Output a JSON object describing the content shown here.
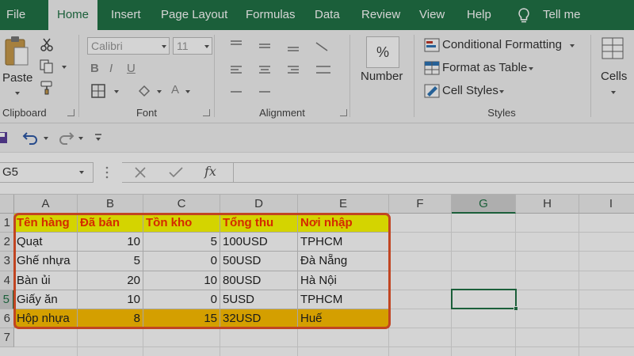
{
  "tabs": {
    "file": "File",
    "home": "Home",
    "insert": "Insert",
    "page_layout": "Page Layout",
    "formulas": "Formulas",
    "data": "Data",
    "review": "Review",
    "view": "View",
    "help": "Help",
    "tell_me": "Tell me"
  },
  "ribbon": {
    "clipboard": {
      "paste_label": "Paste",
      "group_label": "Clipboard"
    },
    "font": {
      "font_name": "Calibri",
      "font_size": "11",
      "group_label": "Font"
    },
    "alignment": {
      "group_label": "Alignment"
    },
    "number": {
      "percent_symbol": "%",
      "label": "Number"
    },
    "styles": {
      "conditional_formatting": "Conditional Formatting",
      "format_as_table": "Format as Table",
      "cell_styles": "Cell Styles",
      "group_label": "Styles"
    },
    "cells": {
      "label": "Cells"
    }
  },
  "formula_bar": {
    "name_box": "G5",
    "fx_symbol": "fx"
  },
  "grid": {
    "columns": [
      "A",
      "B",
      "C",
      "D",
      "E",
      "F",
      "G",
      "H",
      "I"
    ],
    "selected_column": "G",
    "rows": [
      "1",
      "2",
      "3",
      "4",
      "5",
      "6",
      "7"
    ],
    "selected_row": "5",
    "headers": [
      "Tên hàng",
      "Đã bán",
      "Tồn kho",
      "Tổng thu",
      "Nơi nhập"
    ],
    "data": [
      [
        "Quạt",
        "10",
        "5",
        "100USD",
        "TPHCM"
      ],
      [
        "Ghế nhựa",
        "5",
        "0",
        "50USD",
        "Đà Nẵng"
      ],
      [
        "Bàn ủi",
        "20",
        "10",
        "80USD",
        "Hà Nội"
      ],
      [
        "Giấy ăn",
        "10",
        "0",
        "5USD",
        "TPHCM"
      ],
      [
        "Hộp nhựa",
        "8",
        "15",
        "32USD",
        "Huế"
      ]
    ],
    "highlighted_row_index": 4
  },
  "colors": {
    "brand_green": "#217346",
    "header_fill": "#ffff00",
    "header_text": "#ff3300",
    "highlight_fill": "#ffc000",
    "outline": "#e8532a"
  }
}
